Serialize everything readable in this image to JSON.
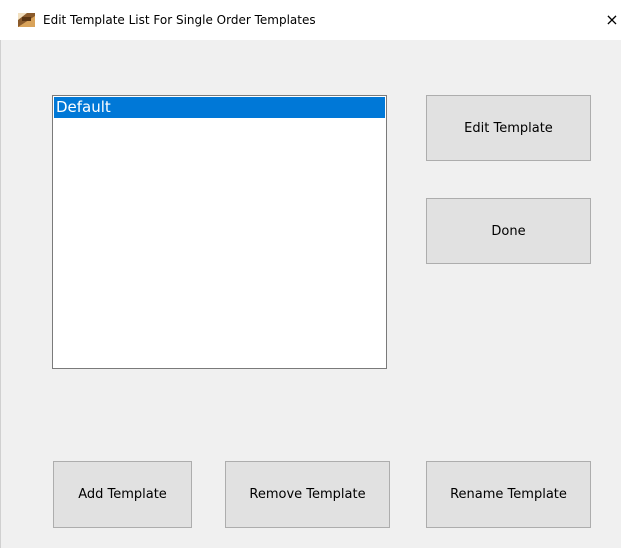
{
  "window": {
    "title": "Edit Template List For Single Order Templates",
    "app_icon": "app-icon",
    "close_glyph": "×"
  },
  "template_list": {
    "items": [
      {
        "label": "Default",
        "selected": true
      }
    ],
    "selection_color": "#0078d7"
  },
  "buttons": {
    "edit_template": "Edit Template",
    "done": "Done",
    "add_template": "Add Template",
    "remove_template": "Remove Template",
    "rename_template": "Rename Template"
  },
  "colors": {
    "dialog_background": "#f0f0f0",
    "button_face": "#e1e1e1",
    "button_border": "#adadad"
  }
}
